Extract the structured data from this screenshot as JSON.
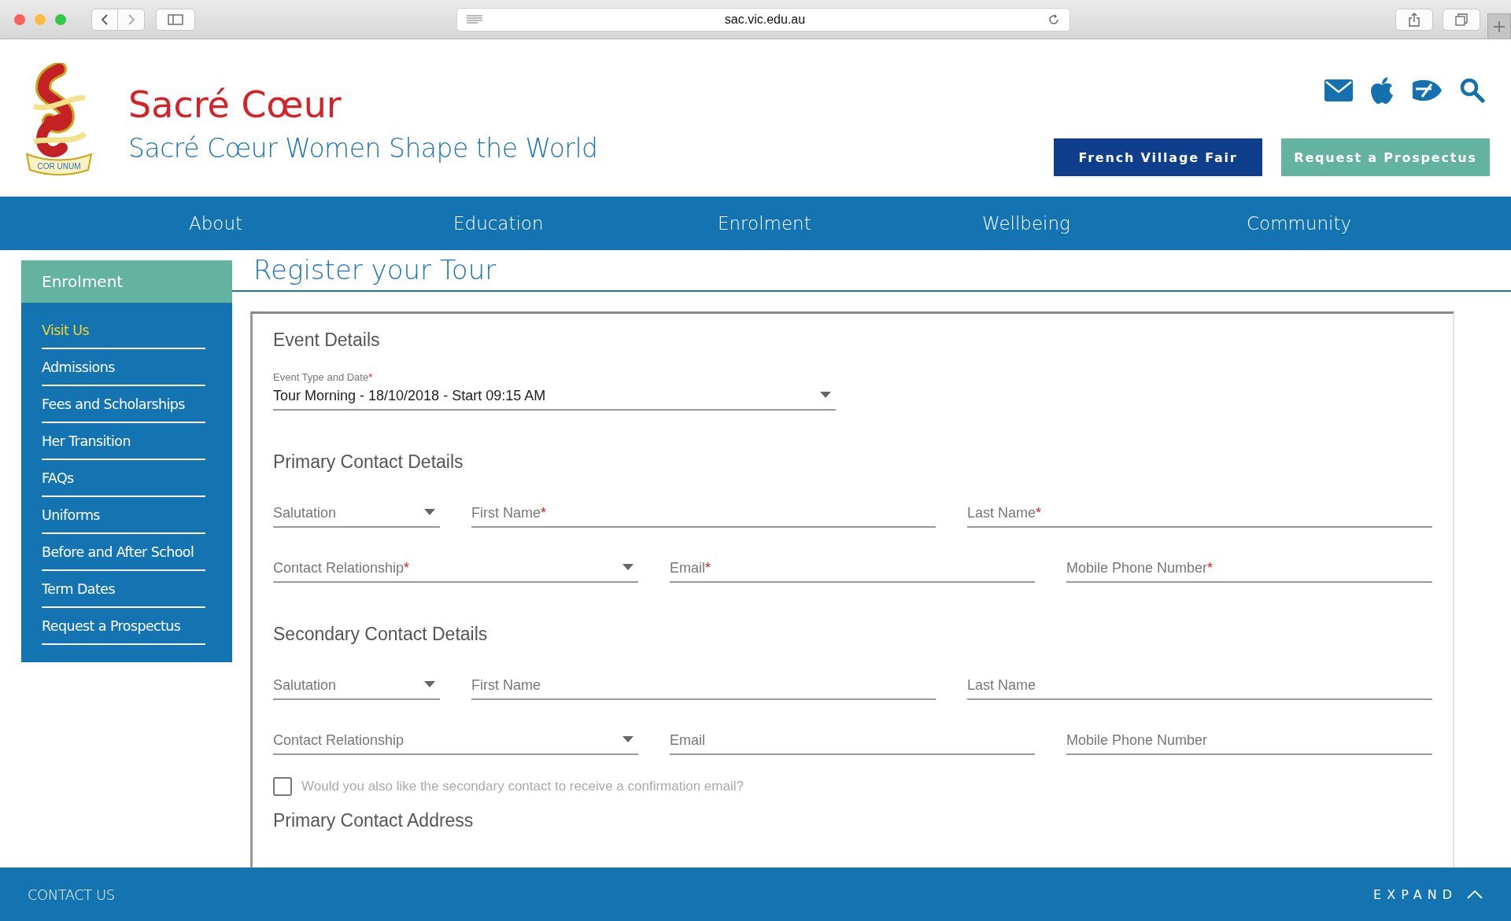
{
  "browser": {
    "url": "sac.vic.edu.au"
  },
  "header": {
    "title": "Sacré Cœur",
    "tagline": "Sacré Cœur Women Shape the World",
    "logo_motto": "COR UNUM",
    "buttons": [
      {
        "label": "French Village Fair",
        "kind": "primary"
      },
      {
        "label": "Request a Prospectus",
        "kind": "accent"
      }
    ]
  },
  "nav": [
    "About",
    "Education",
    "Enrolment",
    "Wellbeing",
    "Community"
  ],
  "sidebar": {
    "heading": "Enrolment",
    "items": [
      {
        "label": "Visit Us",
        "selected": true
      },
      {
        "label": "Admissions",
        "selected": false
      },
      {
        "label": "Fees and Scholarships",
        "selected": false
      },
      {
        "label": "Her Transition",
        "selected": false
      },
      {
        "label": "FAQs",
        "selected": false
      },
      {
        "label": "Uniforms",
        "selected": false
      },
      {
        "label": "Before and After School",
        "selected": false
      },
      {
        "label": "Term Dates",
        "selected": false
      },
      {
        "label": "Request a Prospectus",
        "selected": false
      }
    ]
  },
  "page_title": "Register your Tour",
  "form": {
    "sections": [
      {
        "title": "Event Details",
        "rows": [
          {
            "kind": "event",
            "fields": [
              {
                "label": "Event Type and Date",
                "required_mark": "*",
                "kind": "select",
                "value": "Tour Morning - 18/10/2018 - Start 09:15 AM"
              }
            ]
          }
        ]
      },
      {
        "title": "Primary Contact Details",
        "rows": [
          {
            "kind": "name",
            "fields": [
              {
                "label": "Salutation",
                "kind": "select"
              },
              {
                "label": "First Name",
                "required_mark": "*",
                "kind": "text"
              },
              {
                "label": "Last Name",
                "required_mark": "*",
                "kind": "text"
              }
            ]
          },
          {
            "kind": "contact",
            "fields": [
              {
                "label": "Contact Relationship",
                "required_mark": "*",
                "kind": "select"
              },
              {
                "label": "Email",
                "required_mark": "*",
                "kind": "text"
              },
              {
                "label": "Mobile Phone Number",
                "required_mark": "*",
                "kind": "text"
              }
            ]
          }
        ]
      },
      {
        "title": "Secondary Contact Details",
        "rows": [
          {
            "kind": "name",
            "fields": [
              {
                "label": "Salutation",
                "kind": "select"
              },
              {
                "label": "First Name",
                "kind": "text"
              },
              {
                "label": "Last Name",
                "kind": "text"
              }
            ]
          },
          {
            "kind": "contact",
            "fields": [
              {
                "label": "Contact Relationship",
                "kind": "select"
              },
              {
                "label": "Email",
                "kind": "text"
              },
              {
                "label": "Mobile Phone Number",
                "kind": "text"
              }
            ]
          }
        ]
      }
    ],
    "checkbox": {
      "label": "Would you also like the secondary contact to receive a confirmation email?",
      "checked": false
    },
    "next_section_title": "Primary Contact Address"
  },
  "footer": {
    "contact": "CONTACT US",
    "expand": "EXPAND"
  }
}
